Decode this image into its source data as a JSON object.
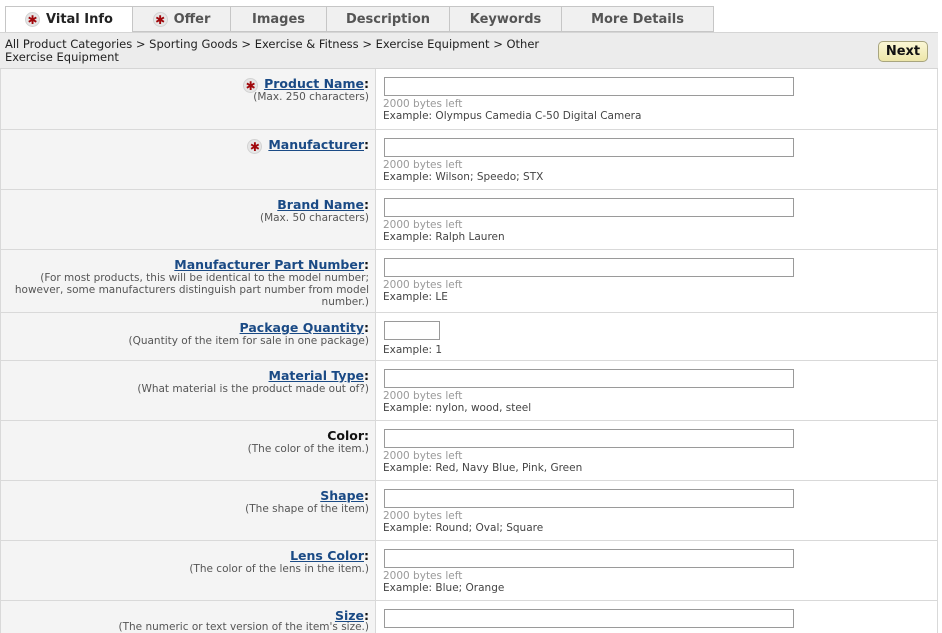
{
  "tabs": [
    {
      "label": "Vital Info",
      "required": true,
      "active": true
    },
    {
      "label": "Offer",
      "required": true,
      "active": false
    },
    {
      "label": "Images",
      "required": false,
      "active": false
    },
    {
      "label": "Description",
      "required": false,
      "active": false
    },
    {
      "label": "Keywords",
      "required": false,
      "active": false
    },
    {
      "label": "More Details",
      "required": false,
      "active": false
    }
  ],
  "breadcrumb": {
    "line1": "All Product Categories > Sporting Goods > Exercise & Fitness > Exercise Equipment > Other",
    "line2": "Exercise Equipment"
  },
  "next_label": "Next",
  "fields": [
    {
      "label": "Product Name",
      "hint": "(Max. 250 characters)",
      "value": "",
      "bytes_left": "2000 bytes left",
      "example": "Example: Olympus Camedia C-50 Digital Camera"
    },
    {
      "label": "Manufacturer",
      "hint": "",
      "value": "",
      "bytes_left": "2000 bytes left",
      "example": "Example: Wilson; Speedo; STX"
    },
    {
      "label": "Brand Name",
      "hint": "(Max. 50 characters)",
      "value": "",
      "bytes_left": "2000 bytes left",
      "example": "Example: Ralph Lauren"
    },
    {
      "label": "Manufacturer Part Number",
      "hint": "(For most products, this will be identical to the model number; however, some manufacturers distinguish part number from model number.)",
      "value": "",
      "bytes_left": "2000 bytes left",
      "example": "Example: LE"
    },
    {
      "label": "Package Quantity",
      "hint": "(Quantity of the item for sale in one package)",
      "value": "",
      "bytes_left": "",
      "example": "Example: 1"
    },
    {
      "label": "Material Type",
      "hint": "(What material is the product made out of?)",
      "value": "",
      "bytes_left": "2000 bytes left",
      "example": "Example: nylon, wood, steel"
    },
    {
      "label": "Color",
      "hint": "(The color of the item.)",
      "value": "",
      "bytes_left": "2000 bytes left",
      "example": "Example: Red, Navy Blue, Pink, Green"
    },
    {
      "label": "Shape",
      "hint": "(The shape of the item)",
      "value": "",
      "bytes_left": "2000 bytes left",
      "example": "Example: Round; Oval; Square"
    },
    {
      "label": "Lens Color",
      "hint": "(The color of the lens in the item.)",
      "value": "",
      "bytes_left": "2000 bytes left",
      "example": "Example: Blue; Orange"
    },
    {
      "label": "Size",
      "hint": "(The numeric or text version of the item's size.)",
      "value": "",
      "bytes_left": "",
      "example": ""
    }
  ],
  "colors": {
    "link": "#1a4a85",
    "required_star": "#a0070b",
    "next_button": "#ede6a8"
  }
}
